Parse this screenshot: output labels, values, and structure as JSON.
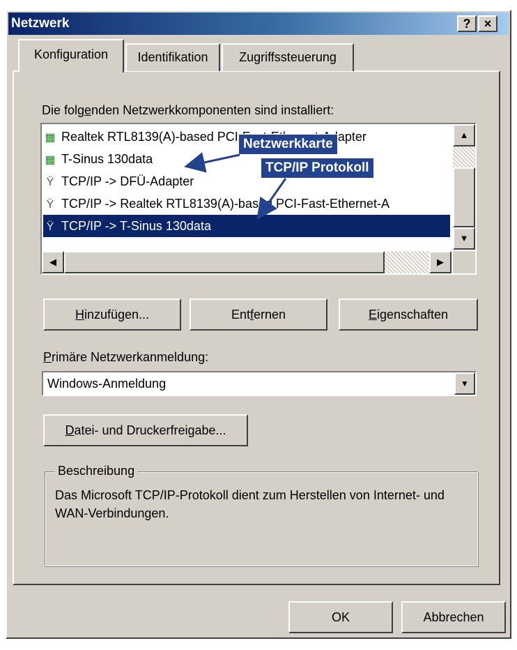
{
  "window": {
    "title": "Netzwerk",
    "help_button": "?",
    "close_button": "×"
  },
  "tabs": [
    {
      "label": "Konfiguration",
      "active": true
    },
    {
      "label": "Identifikation",
      "active": false
    },
    {
      "label": "Zugriffssteuerung",
      "active": false
    }
  ],
  "components": {
    "label_pre": "Die folg",
    "label_key": "e",
    "label_post": "nden Netzwerkkomponenten sind installiert:",
    "items": [
      {
        "icon": "network-adapter-icon",
        "text": "Realtek RTL8139(A)-based PCI-Fast-Ethernet-Adapter",
        "selected": false
      },
      {
        "icon": "network-adapter-icon",
        "text": "T-Sinus 130data",
        "selected": false
      },
      {
        "icon": "protocol-icon",
        "text": "TCP/IP -> DFÜ-Adapter",
        "selected": false
      },
      {
        "icon": "protocol-icon",
        "text": "TCP/IP -> Realtek RTL8139(A)-based PCI-Fast-Ethernet-A",
        "selected": false
      },
      {
        "icon": "protocol-icon",
        "text": "TCP/IP -> T-Sinus 130data",
        "selected": true
      }
    ]
  },
  "annotations": {
    "network_card": "Netzwerkkarte",
    "tcpip": "TCP/IP Protokoll"
  },
  "buttons": {
    "add": {
      "key": "H",
      "rest": "inzufügen..."
    },
    "remove": {
      "pre": "Ent",
      "key": "f",
      "post": "ernen"
    },
    "properties": {
      "key": "E",
      "rest": "igenschaften"
    },
    "file_print": {
      "key": "D",
      "rest": "atei- und Druckerfreigabe..."
    },
    "ok": "OK",
    "cancel": "Abbrechen"
  },
  "logon": {
    "label_key": "P",
    "label_rest": "rimäre Netzwerkanmeldung:",
    "value": "Windows-Anmeldung"
  },
  "description": {
    "legend": "Beschreibung",
    "text": "Das Microsoft TCP/IP-Protokoll dient zum Herstellen von Internet- und WAN-Verbindungen."
  },
  "colors": {
    "title_bar": "#0a246a",
    "selection": "#0a246a",
    "annotation_bg": "#24438f",
    "dialog_face": "#d4d0c8"
  }
}
